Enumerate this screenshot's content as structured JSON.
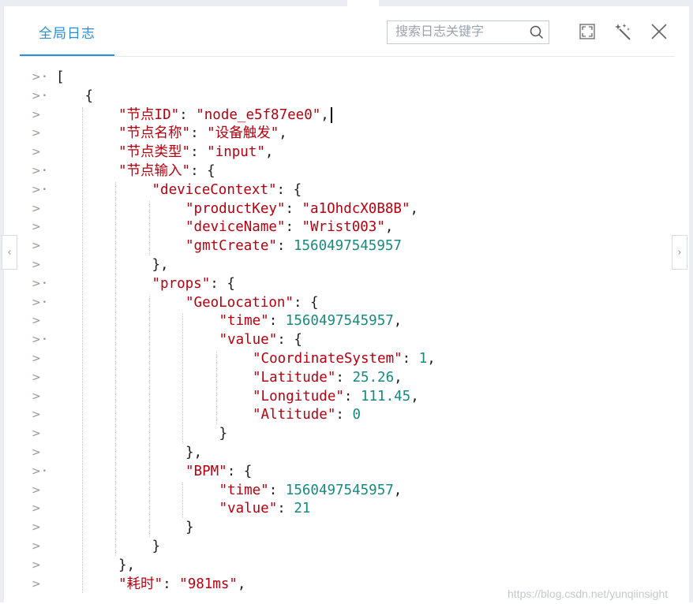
{
  "header": {
    "active_tab": "全局日志",
    "search_placeholder": "搜索日志关键字"
  },
  "toolbar": {
    "icons": [
      "search-icon",
      "fullscreen-icon",
      "format-wand-icon",
      "close-icon"
    ]
  },
  "nav": {
    "prev_symbol": "‹",
    "next_symbol": "›"
  },
  "gutter_symbol": ">",
  "code_lines": [
    {
      "indent": 0,
      "fold": true,
      "parts": [
        {
          "t": "[",
          "c": "punc"
        }
      ]
    },
    {
      "indent": 1,
      "fold": true,
      "parts": [
        {
          "t": "{",
          "c": "punc"
        }
      ]
    },
    {
      "indent": 2,
      "fold": false,
      "cursor": true,
      "parts": [
        {
          "t": "\"节点ID\"",
          "c": "key"
        },
        {
          "t": ": ",
          "c": "punc"
        },
        {
          "t": "\"node_e5f87ee0\"",
          "c": "str"
        },
        {
          "t": ",",
          "c": "punc"
        }
      ]
    },
    {
      "indent": 2,
      "fold": false,
      "parts": [
        {
          "t": "\"节点名称\"",
          "c": "key"
        },
        {
          "t": ": ",
          "c": "punc"
        },
        {
          "t": "\"设备触发\"",
          "c": "str"
        },
        {
          "t": ",",
          "c": "punc"
        }
      ]
    },
    {
      "indent": 2,
      "fold": false,
      "parts": [
        {
          "t": "\"节点类型\"",
          "c": "key"
        },
        {
          "t": ": ",
          "c": "punc"
        },
        {
          "t": "\"input\"",
          "c": "str"
        },
        {
          "t": ",",
          "c": "punc"
        }
      ]
    },
    {
      "indent": 2,
      "fold": true,
      "parts": [
        {
          "t": "\"节点输入\"",
          "c": "key"
        },
        {
          "t": ": {",
          "c": "punc"
        }
      ]
    },
    {
      "indent": 3,
      "fold": true,
      "parts": [
        {
          "t": "\"deviceContext\"",
          "c": "key"
        },
        {
          "t": ": {",
          "c": "punc"
        }
      ]
    },
    {
      "indent": 4,
      "fold": false,
      "parts": [
        {
          "t": "\"productKey\"",
          "c": "key"
        },
        {
          "t": ": ",
          "c": "punc"
        },
        {
          "t": "\"a1OhdcX0B8B\"",
          "c": "str"
        },
        {
          "t": ",",
          "c": "punc"
        }
      ]
    },
    {
      "indent": 4,
      "fold": false,
      "parts": [
        {
          "t": "\"deviceName\"",
          "c": "key"
        },
        {
          "t": ": ",
          "c": "punc"
        },
        {
          "t": "\"Wrist003\"",
          "c": "str"
        },
        {
          "t": ",",
          "c": "punc"
        }
      ]
    },
    {
      "indent": 4,
      "fold": false,
      "parts": [
        {
          "t": "\"gmtCreate\"",
          "c": "key"
        },
        {
          "t": ": ",
          "c": "punc"
        },
        {
          "t": "1560497545957",
          "c": "num"
        }
      ]
    },
    {
      "indent": 3,
      "fold": false,
      "parts": [
        {
          "t": "},",
          "c": "punc"
        }
      ]
    },
    {
      "indent": 3,
      "fold": true,
      "parts": [
        {
          "t": "\"props\"",
          "c": "key"
        },
        {
          "t": ": {",
          "c": "punc"
        }
      ]
    },
    {
      "indent": 4,
      "fold": true,
      "parts": [
        {
          "t": "\"GeoLocation\"",
          "c": "key"
        },
        {
          "t": ": {",
          "c": "punc"
        }
      ]
    },
    {
      "indent": 5,
      "fold": false,
      "parts": [
        {
          "t": "\"time\"",
          "c": "key"
        },
        {
          "t": ": ",
          "c": "punc"
        },
        {
          "t": "1560497545957",
          "c": "num"
        },
        {
          "t": ",",
          "c": "punc"
        }
      ]
    },
    {
      "indent": 5,
      "fold": true,
      "parts": [
        {
          "t": "\"value\"",
          "c": "key"
        },
        {
          "t": ": {",
          "c": "punc"
        }
      ]
    },
    {
      "indent": 6,
      "fold": false,
      "parts": [
        {
          "t": "\"CoordinateSystem\"",
          "c": "key"
        },
        {
          "t": ": ",
          "c": "punc"
        },
        {
          "t": "1",
          "c": "num"
        },
        {
          "t": ",",
          "c": "punc"
        }
      ]
    },
    {
      "indent": 6,
      "fold": false,
      "parts": [
        {
          "t": "\"Latitude\"",
          "c": "key"
        },
        {
          "t": ": ",
          "c": "punc"
        },
        {
          "t": "25.26",
          "c": "num"
        },
        {
          "t": ",",
          "c": "punc"
        }
      ]
    },
    {
      "indent": 6,
      "fold": false,
      "parts": [
        {
          "t": "\"Longitude\"",
          "c": "key"
        },
        {
          "t": ": ",
          "c": "punc"
        },
        {
          "t": "111.45",
          "c": "num"
        },
        {
          "t": ",",
          "c": "punc"
        }
      ]
    },
    {
      "indent": 6,
      "fold": false,
      "parts": [
        {
          "t": "\"Altitude\"",
          "c": "key"
        },
        {
          "t": ": ",
          "c": "punc"
        },
        {
          "t": "0",
          "c": "num"
        }
      ]
    },
    {
      "indent": 5,
      "fold": false,
      "parts": [
        {
          "t": "}",
          "c": "punc"
        }
      ]
    },
    {
      "indent": 4,
      "fold": false,
      "parts": [
        {
          "t": "},",
          "c": "punc"
        }
      ]
    },
    {
      "indent": 4,
      "fold": true,
      "parts": [
        {
          "t": "\"BPM\"",
          "c": "key"
        },
        {
          "t": ": {",
          "c": "punc"
        }
      ]
    },
    {
      "indent": 5,
      "fold": false,
      "parts": [
        {
          "t": "\"time\"",
          "c": "key"
        },
        {
          "t": ": ",
          "c": "punc"
        },
        {
          "t": "1560497545957",
          "c": "num"
        },
        {
          "t": ",",
          "c": "punc"
        }
      ]
    },
    {
      "indent": 5,
      "fold": false,
      "parts": [
        {
          "t": "\"value\"",
          "c": "key"
        },
        {
          "t": ": ",
          "c": "punc"
        },
        {
          "t": "21",
          "c": "num"
        }
      ]
    },
    {
      "indent": 4,
      "fold": false,
      "parts": [
        {
          "t": "}",
          "c": "punc"
        }
      ]
    },
    {
      "indent": 3,
      "fold": false,
      "parts": [
        {
          "t": "}",
          "c": "punc"
        }
      ]
    },
    {
      "indent": 2,
      "fold": false,
      "parts": [
        {
          "t": "},",
          "c": "punc"
        }
      ]
    },
    {
      "indent": 2,
      "fold": false,
      "parts": [
        {
          "t": "\"耗时\"",
          "c": "key"
        },
        {
          "t": ": ",
          "c": "punc"
        },
        {
          "t": "\"981ms\"",
          "c": "str"
        },
        {
          "t": ",",
          "c": "punc"
        }
      ]
    }
  ],
  "colors": {
    "accent": "#2c8ed6",
    "key": "#b5000f",
    "string": "#b5000f",
    "number": "#178a7d"
  },
  "watermark": "https://blog.csdn.net/yunqiinsight"
}
